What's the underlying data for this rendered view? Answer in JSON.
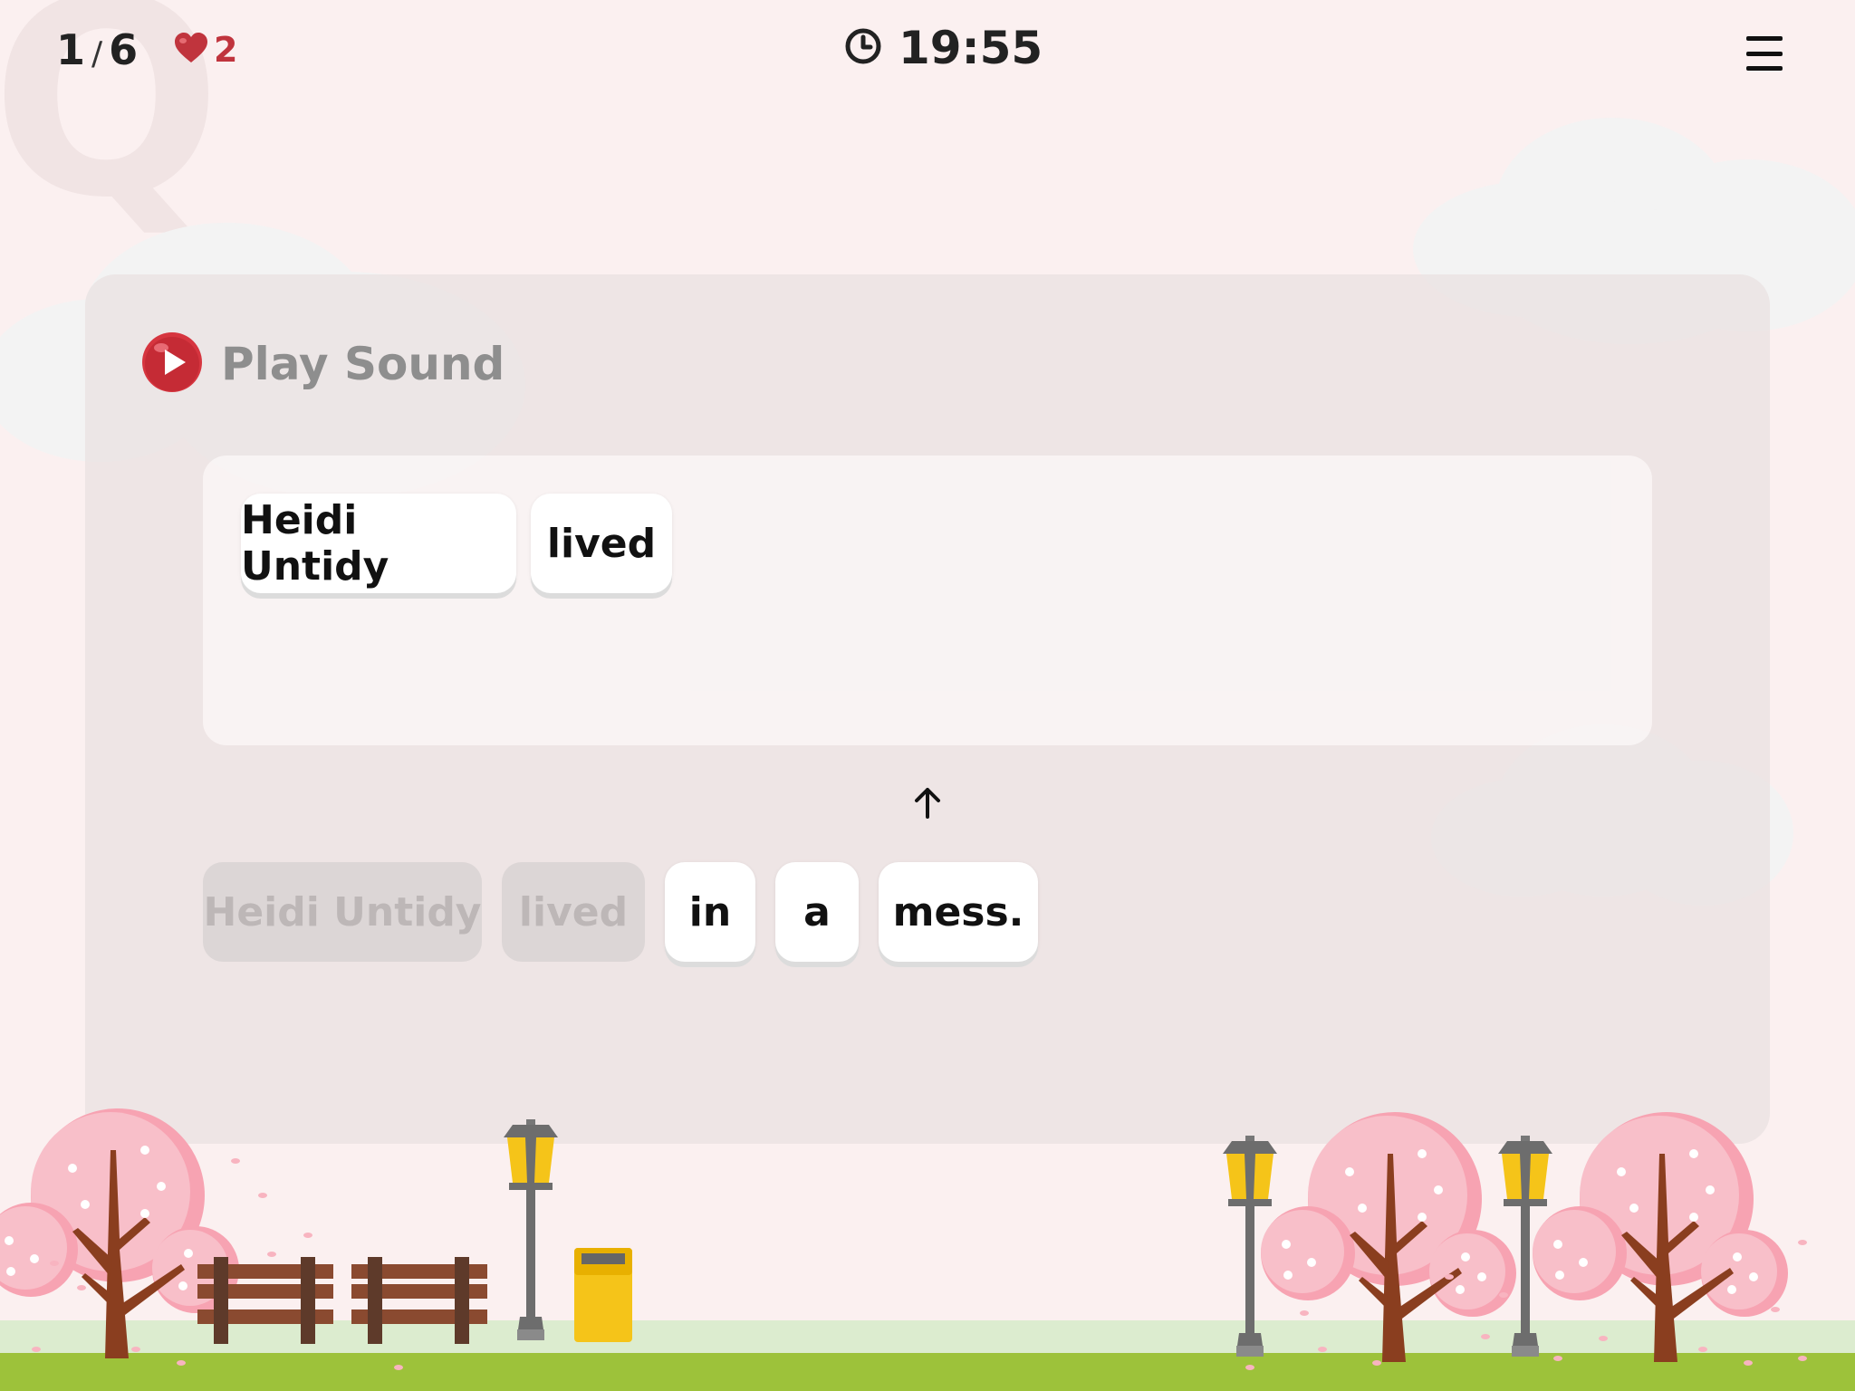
{
  "header": {
    "progress_current": "1",
    "progress_separator": "/",
    "progress_total": "6",
    "lives": "2",
    "timer": "19:55"
  },
  "question": {
    "play_sound_label": "Play Sound"
  },
  "answer_tiles": [
    "Heidi Untidy",
    "lived"
  ],
  "word_bank": [
    {
      "text": "Heidi Untidy",
      "used": true
    },
    {
      "text": "lived",
      "used": true
    },
    {
      "text": "in",
      "used": false
    },
    {
      "text": "a",
      "used": false
    },
    {
      "text": "mess.",
      "used": false
    }
  ],
  "colors": {
    "background": "#fbf0f0",
    "heart": "#c0343d",
    "play_button": "#d6353f",
    "blossom": "#f8b4c0",
    "trunk": "#8a3e1f",
    "grass": "#9dc23a",
    "lamp": "#f5c419"
  },
  "icons": {
    "heart": "heart-icon",
    "timer": "clock-icon",
    "menu": "hamburger-menu-icon",
    "play": "play-circle-icon",
    "arrow": "arrow-up-icon"
  }
}
